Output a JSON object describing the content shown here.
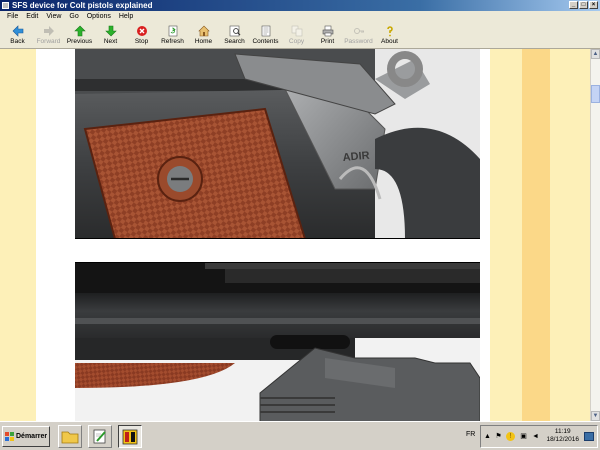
{
  "window": {
    "title": "SFS device for Colt pistols explained"
  },
  "menu": [
    "File",
    "Edit",
    "View",
    "Go",
    "Options",
    "Help"
  ],
  "toolbar": [
    {
      "label": "Back",
      "icon": "back-icon",
      "enabled": true
    },
    {
      "label": "Forward",
      "icon": "forward-icon",
      "enabled": false
    },
    {
      "label": "Previous",
      "icon": "previous-icon",
      "enabled": true
    },
    {
      "label": "Next",
      "icon": "next-icon",
      "enabled": true
    },
    {
      "label": "Stop",
      "icon": "stop-icon",
      "enabled": true
    },
    {
      "label": "Refresh",
      "icon": "refresh-icon",
      "enabled": true
    },
    {
      "label": "Home",
      "icon": "home-icon",
      "enabled": true
    },
    {
      "label": "Search",
      "icon": "search-icon",
      "enabled": true
    },
    {
      "label": "Contents",
      "icon": "contents-icon",
      "enabled": true
    },
    {
      "label": "Copy",
      "icon": "copy-icon",
      "enabled": false
    },
    {
      "label": "Print",
      "icon": "print-icon",
      "enabled": true
    },
    {
      "label": "Password",
      "icon": "password-icon",
      "enabled": false
    },
    {
      "label": "About",
      "icon": "about-icon",
      "enabled": true
    }
  ],
  "content": {
    "photo1_engraving": "ADIR"
  },
  "taskbar": {
    "start_label": "Démarrer",
    "language": "FR",
    "time": "11:19",
    "date": "18/12/2016"
  },
  "colors": {
    "page_margin": "#fdf0b8",
    "page_margin_band": "#fbd888",
    "grip_wood": "#8b3a22",
    "steel": "#4a4c4e"
  }
}
